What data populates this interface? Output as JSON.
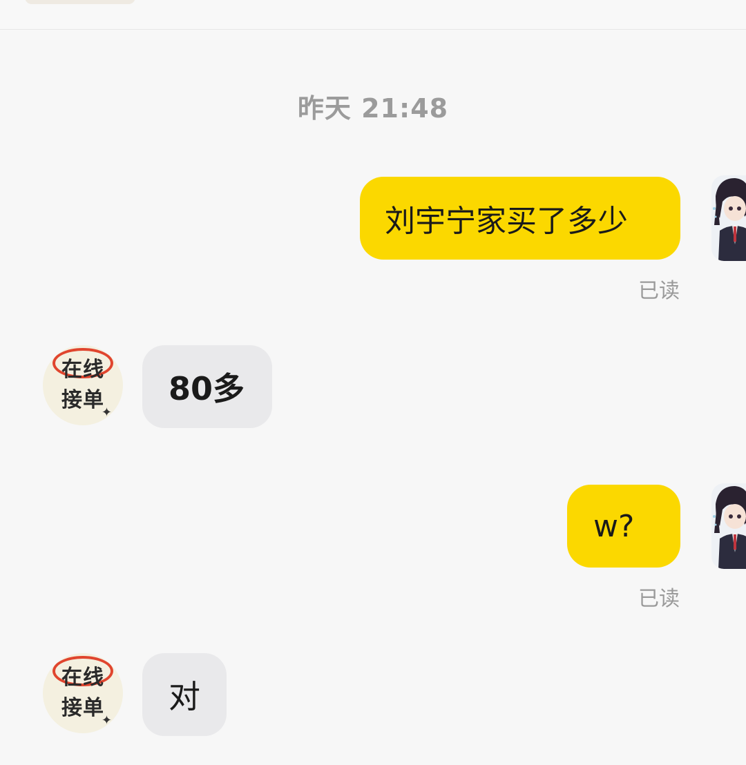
{
  "timestamp": "昨天 21:48",
  "messages": [
    {
      "text": "刘宇宁家买了多少",
      "status": "已读"
    },
    {
      "text": "80多"
    },
    {
      "text": "w?",
      "status": "已读"
    },
    {
      "text": "对"
    }
  ],
  "sticker": {
    "line1": "在线",
    "line2": "接单"
  },
  "colors": {
    "outgoing_bubble": "#fbd800",
    "incoming_bubble": "#e9e9eb",
    "background": "#f7f7f7"
  },
  "icons": {
    "user_avatar": "anime-girl-avatar",
    "contact_avatar": "online-orders-sticker",
    "sparkle": "sparkle-icon"
  }
}
